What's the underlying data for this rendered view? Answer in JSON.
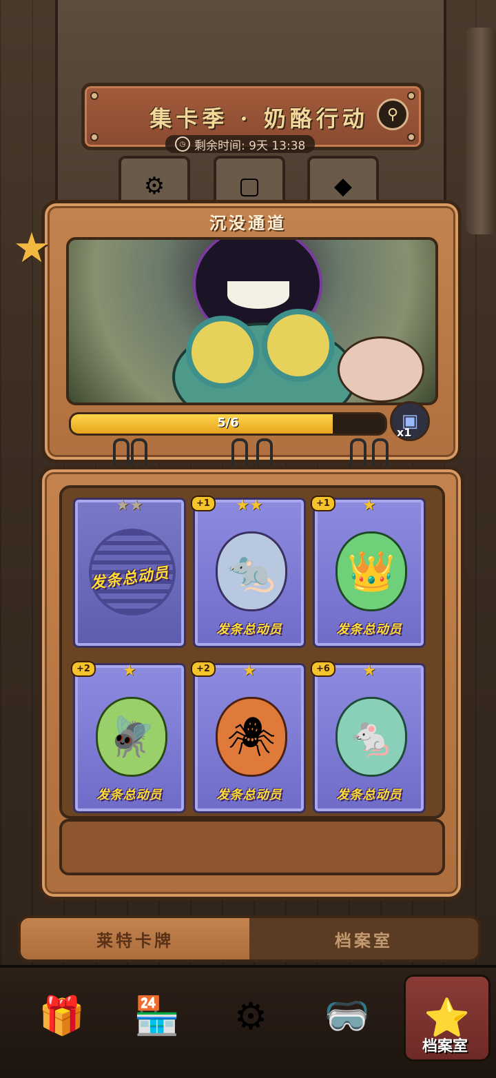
{
  "header": {
    "title": "集卡季 · 奶酪行动",
    "timer_label": "剩余时间: 9天 13:38"
  },
  "album": {
    "section_title": "沉没通道",
    "progress_text": "5/6",
    "progress_fraction": 0.833,
    "reward_count": "x1"
  },
  "cards": [
    {
      "label": "发条总动员",
      "count": "",
      "stars": "★★",
      "locked": true
    },
    {
      "label": "发条总动员",
      "count": "+1",
      "stars": "★★",
      "locked": false
    },
    {
      "label": "发条总动员",
      "count": "+1",
      "stars": "★",
      "locked": false
    },
    {
      "label": "发条总动员",
      "count": "+2",
      "stars": "★",
      "locked": false
    },
    {
      "label": "发条总动员",
      "count": "+2",
      "stars": "★",
      "locked": false
    },
    {
      "label": "发条总动员",
      "count": "+6",
      "stars": "★",
      "locked": false
    }
  ],
  "toggle": {
    "left_label": "莱特卡牌",
    "right_label": "档案室"
  },
  "nav": {
    "active_label": "档案室"
  },
  "colors": {
    "accent_gold": "#f5c32c",
    "card_purple": "#8d8be0",
    "leather": "#c4834e"
  }
}
